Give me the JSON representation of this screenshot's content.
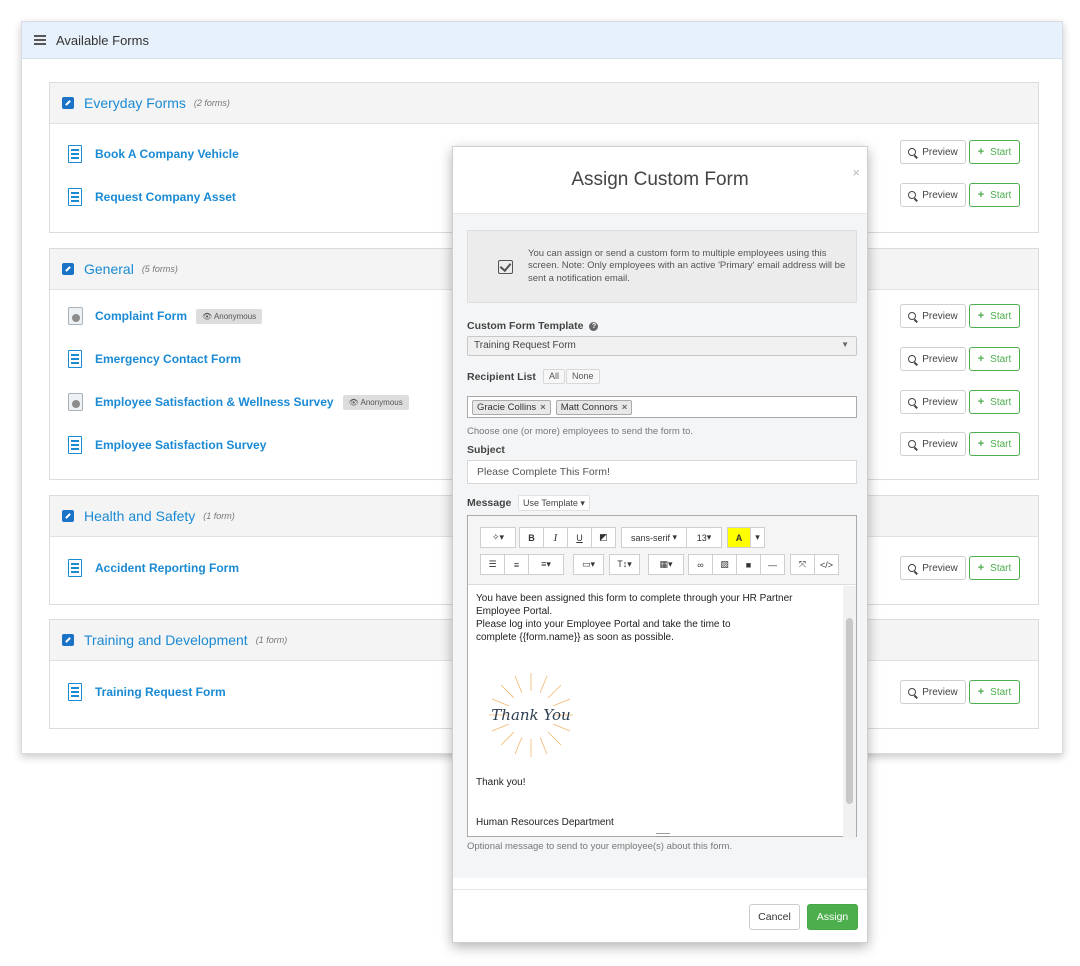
{
  "panel": {
    "title": "Available Forms"
  },
  "groups": [
    {
      "title": "Everyday Forms",
      "count": "(2 forms)",
      "forms": [
        {
          "name": "Book A Company Vehicle"
        },
        {
          "name": "Request Company Asset"
        }
      ]
    },
    {
      "title": "General",
      "count": "(5 forms)",
      "forms": [
        {
          "name": "Complaint Form",
          "badge": "Anonymous"
        },
        {
          "name": "Emergency Contact Form"
        },
        {
          "name": "Employee Satisfaction & Wellness Survey",
          "badge": "Anonymous"
        },
        {
          "name": "Employee Satisfaction Survey"
        }
      ]
    },
    {
      "title": "Health and Safety",
      "count": "(1 form)",
      "forms": [
        {
          "name": "Accident Reporting Form"
        }
      ]
    },
    {
      "title": "Training and Development",
      "count": "(1 form)",
      "forms": [
        {
          "name": "Training Request Form"
        }
      ]
    }
  ],
  "buttons": {
    "preview": "Preview",
    "start": "Start"
  },
  "modal": {
    "title": "Assign Custom Form",
    "close": "×",
    "info": "You can assign or send a custom form to multiple employees using this screen. Note: Only employees with an active 'Primary' email address will be sent a notification email.",
    "template_label": "Custom Form Template",
    "template_value": "Training Request Form",
    "recipient_label": "Recipient List",
    "all_label": "All",
    "none_label": "None",
    "recipients": [
      "Gracie Collins",
      "Matt Connors"
    ],
    "recipient_help": "Choose one (or more) employees to send the form to.",
    "subject_label": "Subject",
    "subject_value": "Please Complete This Form!",
    "message_label": "Message",
    "use_template": "Use Template",
    "toolbar": {
      "font": "sans-serif",
      "size": "13"
    },
    "message_lines": {
      "p1": "You have been assigned this form to complete through your HR Partner Employee Portal.",
      "p2": "Please log into your Employee Portal and take the time to complete {{form.name}} as soon as possible.",
      "image_text": "Thank You",
      "p3": "Thank you!",
      "p4": "Human Resources Department"
    },
    "message_help": "Optional message to send to your employee(s) about this form.",
    "cancel": "Cancel",
    "assign": "Assign"
  }
}
